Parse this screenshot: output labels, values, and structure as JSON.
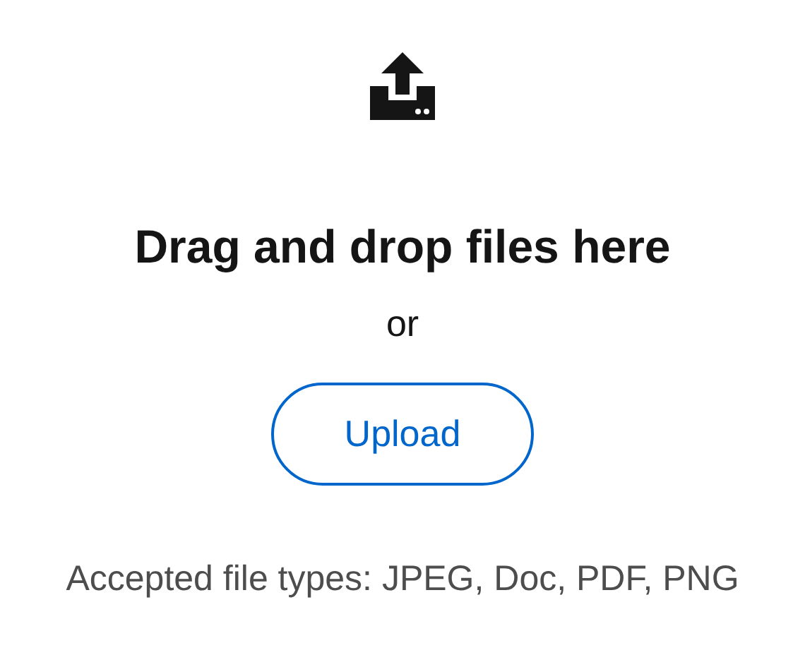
{
  "title": "Drag and drop files here",
  "separator": "or",
  "upload_button": {
    "label": "Upload"
  },
  "helper_text": "Accepted file types: JPEG, Doc, PDF, PNG"
}
